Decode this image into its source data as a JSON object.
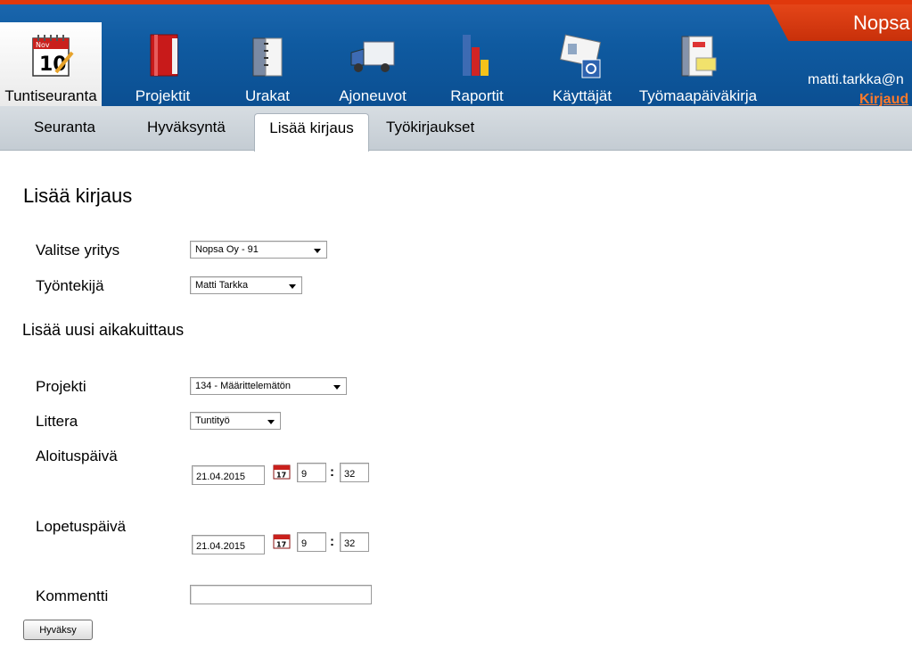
{
  "header": {
    "brand": "Nopsa",
    "user_email": "matti.tarkka@n",
    "logout_link": "Kirjaud"
  },
  "nav": {
    "items": [
      {
        "label": "Tuntiseuranta",
        "icon": "calendar-icon",
        "active": true
      },
      {
        "label": "Projektit",
        "icon": "red-folder-icon"
      },
      {
        "label": "Urakat",
        "icon": "binder-icon"
      },
      {
        "label": "Ajoneuvot",
        "icon": "truck-icon"
      },
      {
        "label": "Raportit",
        "icon": "bar-chart-icon"
      },
      {
        "label": "Käyttäjät",
        "icon": "id-card-gear-icon"
      },
      {
        "label": "Työmaapäiväkirja",
        "icon": "notebook-icon"
      }
    ]
  },
  "subtabs": [
    {
      "label": "Seuranta"
    },
    {
      "label": "Hyväksyntä"
    },
    {
      "label": "Lisää kirjaus",
      "active": true
    },
    {
      "label": "Työkirjaukset"
    }
  ],
  "form": {
    "title": "Lisää kirjaus",
    "company_label": "Valitse yritys",
    "company_value": "Nopsa Oy - 91",
    "employee_label": "Työntekijä",
    "employee_value": "Matti Tarkka",
    "section_title": "Lisää uusi aikakuittaus",
    "project_label": "Projekti",
    "project_value": "134 - Määrittelemätön",
    "littera_label": "Littera",
    "littera_value": "Tuntityö",
    "start_label": "Aloituspäivä",
    "start_date": "21.04.2015",
    "start_hour": "9",
    "start_minute": "32",
    "end_label": "Lopetuspäivä",
    "end_date": "21.04.2015",
    "end_hour": "9",
    "end_minute": "32",
    "time_separator": ":",
    "calendar_day": "17",
    "comment_label": "Kommentti",
    "comment_value": "",
    "submit_label": "Hyväksy"
  },
  "colors": {
    "header_blue": "#0f5aa0",
    "header_orange": "#e0380c",
    "link_orange": "#ff7a2a",
    "subbar_grey": "#c4ccd3"
  }
}
